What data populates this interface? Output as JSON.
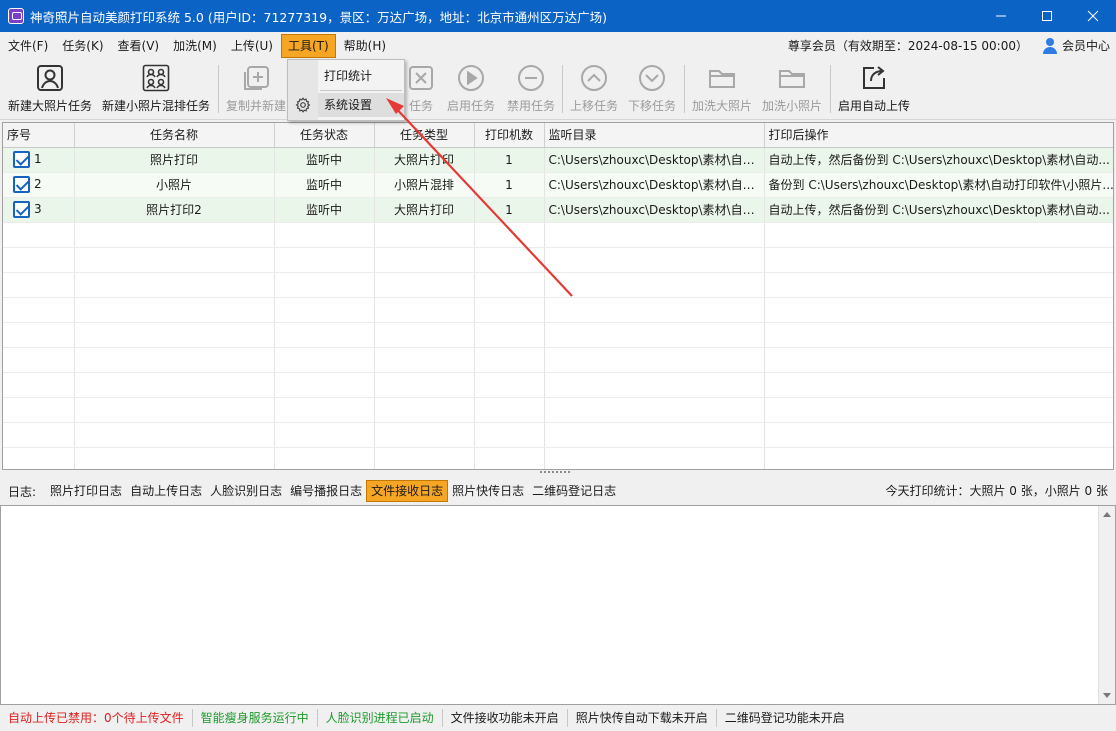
{
  "window": {
    "title": "神奇照片自动美颜打印系统 5.0 (用户ID：71277319，景区：万达广场，地址：北京市通州区万达广场)",
    "minimize_glyph": "—",
    "maximize_glyph": "☐",
    "close_glyph": "✕"
  },
  "menu": {
    "items": [
      "文件(F)",
      "任务(K)",
      "查看(V)",
      "加洗(M)",
      "上传(U)",
      "工具(T)",
      "帮助(H)"
    ],
    "active": "工具(T)",
    "membership": "尊享会员（有效期至：2024-08-15 00:00）",
    "member_center": "会员中心"
  },
  "toolbar": {
    "buttons": [
      {
        "label": "新建大照片任务",
        "icon": "portrait-icon",
        "enabled": true
      },
      {
        "label": "新建小照片混排任务",
        "icon": "grid-portraits-icon",
        "enabled": true
      },
      {
        "label": "复制并新建",
        "icon": "copy-add-icon",
        "enabled": false
      },
      {
        "label": "删除任务",
        "icon": "delete-icon",
        "enabled": false
      },
      {
        "label": "启用任务",
        "icon": "play-icon",
        "enabled": false
      },
      {
        "label": "禁用任务",
        "icon": "minus-icon",
        "enabled": false
      },
      {
        "label": "上移任务",
        "icon": "up-icon",
        "enabled": false
      },
      {
        "label": "下移任务",
        "icon": "down-icon",
        "enabled": false
      },
      {
        "label": "加洗大照片",
        "icon": "folder-icon",
        "enabled": false
      },
      {
        "label": "加洗小照片",
        "icon": "folder-icon",
        "enabled": false
      },
      {
        "label": "启用自动上传",
        "icon": "upload-icon",
        "enabled": true
      }
    ],
    "partial_delete_label": "任务"
  },
  "tools_menu": {
    "items": [
      "打印统计",
      "系统设置"
    ],
    "hovered": "系统设置"
  },
  "table": {
    "headers": [
      "序号",
      "任务名称",
      "任务状态",
      "任务类型",
      "打印机数",
      "监听目录",
      "打印后操作"
    ],
    "rows": [
      {
        "no": "1",
        "name": "照片打印",
        "status": "监听中",
        "type": "大照片打印",
        "printers": "1",
        "dir": "C:\\Users\\zhouxc\\Desktop\\素材\\自动...",
        "after": "自动上传，然后备份到 C:\\Users\\zhouxc\\Desktop\\素材\\自动...",
        "checked": true
      },
      {
        "no": "2",
        "name": "小照片",
        "status": "监听中",
        "type": "小照片混排",
        "printers": "1",
        "dir": "C:\\Users\\zhouxc\\Desktop\\素材\\自动...",
        "after": "备份到 C:\\Users\\zhouxc\\Desktop\\素材\\自动打印软件\\小照片...",
        "checked": true
      },
      {
        "no": "3",
        "name": "照片打印2",
        "status": "监听中",
        "type": "大照片打印",
        "printers": "1",
        "dir": "C:\\Users\\zhouxc\\Desktop\\素材\\自动...",
        "after": "自动上传，然后备份到 C:\\Users\\zhouxc\\Desktop\\素材\\自动...",
        "checked": true
      }
    ]
  },
  "logs": {
    "label": "日志:",
    "tabs": [
      "照片打印日志",
      "自动上传日志",
      "人脸识别日志",
      "编号播报日志",
      "文件接收日志",
      "照片快传日志",
      "二维码登记日志"
    ],
    "active": "文件接收日志",
    "stats": "今天打印统计：大照片 0 张，小照片 0 张"
  },
  "status": {
    "items": [
      {
        "text": "自动上传已禁用：0个待上传文件",
        "color": "red"
      },
      {
        "text": "智能瘦身服务运行中",
        "color": "green"
      },
      {
        "text": "人脸识别进程已启动",
        "color": "green"
      },
      {
        "text": "文件接收功能未开启",
        "color": "normal"
      },
      {
        "text": "照片快传自动下载未开启",
        "color": "normal"
      },
      {
        "text": "二维码登记功能未开启",
        "color": "normal"
      }
    ]
  },
  "colors": {
    "titlebar": "#0b63c6",
    "active_highlight": "#f6a623",
    "annotation_arrow": "#e53935",
    "checkbox": "#1664c0"
  }
}
